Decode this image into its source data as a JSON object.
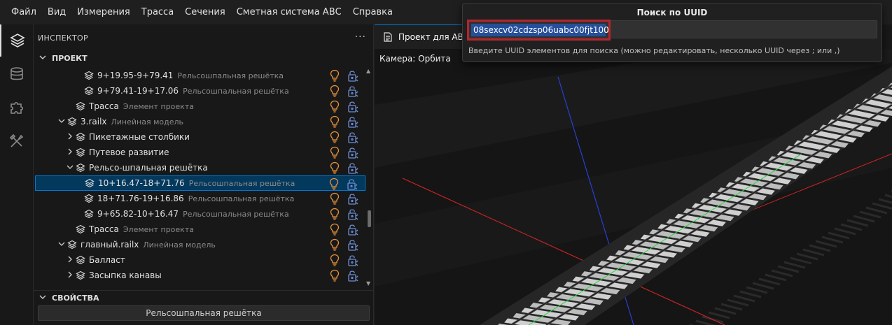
{
  "menu": [
    "Файл",
    "Вид",
    "Измерения",
    "Трасса",
    "Сечения",
    "Сметная система АВС",
    "Справка"
  ],
  "activity": {
    "items": [
      {
        "icon": "layers-icon",
        "active": true
      },
      {
        "icon": "database-icon",
        "active": false
      },
      {
        "icon": "puzzle-icon",
        "active": false
      },
      {
        "icon": "tools-icon",
        "active": false
      }
    ]
  },
  "inspector": {
    "title": "ИНСПЕКТОР",
    "more": "···",
    "project_section": "ПРОЕКТ",
    "properties_section": "СВОЙСТВА",
    "properties_value": "Рельсошпальная решётка"
  },
  "tree": [
    {
      "depth": 3,
      "twist": "",
      "label": "9+19.95-9+79.41",
      "type": "Рельсошпальная решётка",
      "selected": false
    },
    {
      "depth": 3,
      "twist": "",
      "label": "9+79.41-19+17.06",
      "type": "Рельсошпальная решётка",
      "selected": false
    },
    {
      "depth": 2,
      "twist": "",
      "label": "Трасса",
      "type": "Элемент проекта",
      "selected": false
    },
    {
      "depth": 1,
      "twist": "v",
      "label": "3.railx",
      "type": "Линейная модель",
      "selected": false
    },
    {
      "depth": 2,
      "twist": ">",
      "label": "Пикетажные столбики",
      "type": "",
      "selected": false
    },
    {
      "depth": 2,
      "twist": ">",
      "label": "Путевое развитие",
      "type": "",
      "selected": false
    },
    {
      "depth": 2,
      "twist": "v",
      "label": "Рельсо-шпальная решётка",
      "type": "",
      "selected": false
    },
    {
      "depth": 3,
      "twist": "",
      "label": "10+16.47-18+71.76",
      "type": "Рельсошпальная решётка",
      "selected": true
    },
    {
      "depth": 3,
      "twist": "",
      "label": "18+71.76-19+16.86",
      "type": "Рельсошпальная решётка",
      "selected": false
    },
    {
      "depth": 3,
      "twist": "",
      "label": "9+65.82-10+16.47",
      "type": "Рельсошпальная решётка",
      "selected": false
    },
    {
      "depth": 2,
      "twist": "",
      "label": "Трасса",
      "type": "Элемент проекта",
      "selected": false
    },
    {
      "depth": 1,
      "twist": "v",
      "label": "главный.railx",
      "type": "Линейная модель",
      "selected": false
    },
    {
      "depth": 2,
      "twist": ">",
      "label": "Балласт",
      "type": "",
      "selected": false
    },
    {
      "depth": 2,
      "twist": ">",
      "label": "Засыпка канавы",
      "type": "",
      "selected": false
    }
  ],
  "editor": {
    "tab_label": "Проект для АВС",
    "camera_label": "Камера: Орбита"
  },
  "search": {
    "title": "Поиск по UUID",
    "value": "08sexcv02cdzsp06uabc00fjt100",
    "hint": "Введите UUID элементов для поиска (можно редактировать, несколько UUID через ; или ,)"
  },
  "colors": {
    "accent": "#0078d4",
    "highlight_border": "#b3262d",
    "bulb": "#e8913a",
    "lock": "#6e8ed6"
  }
}
